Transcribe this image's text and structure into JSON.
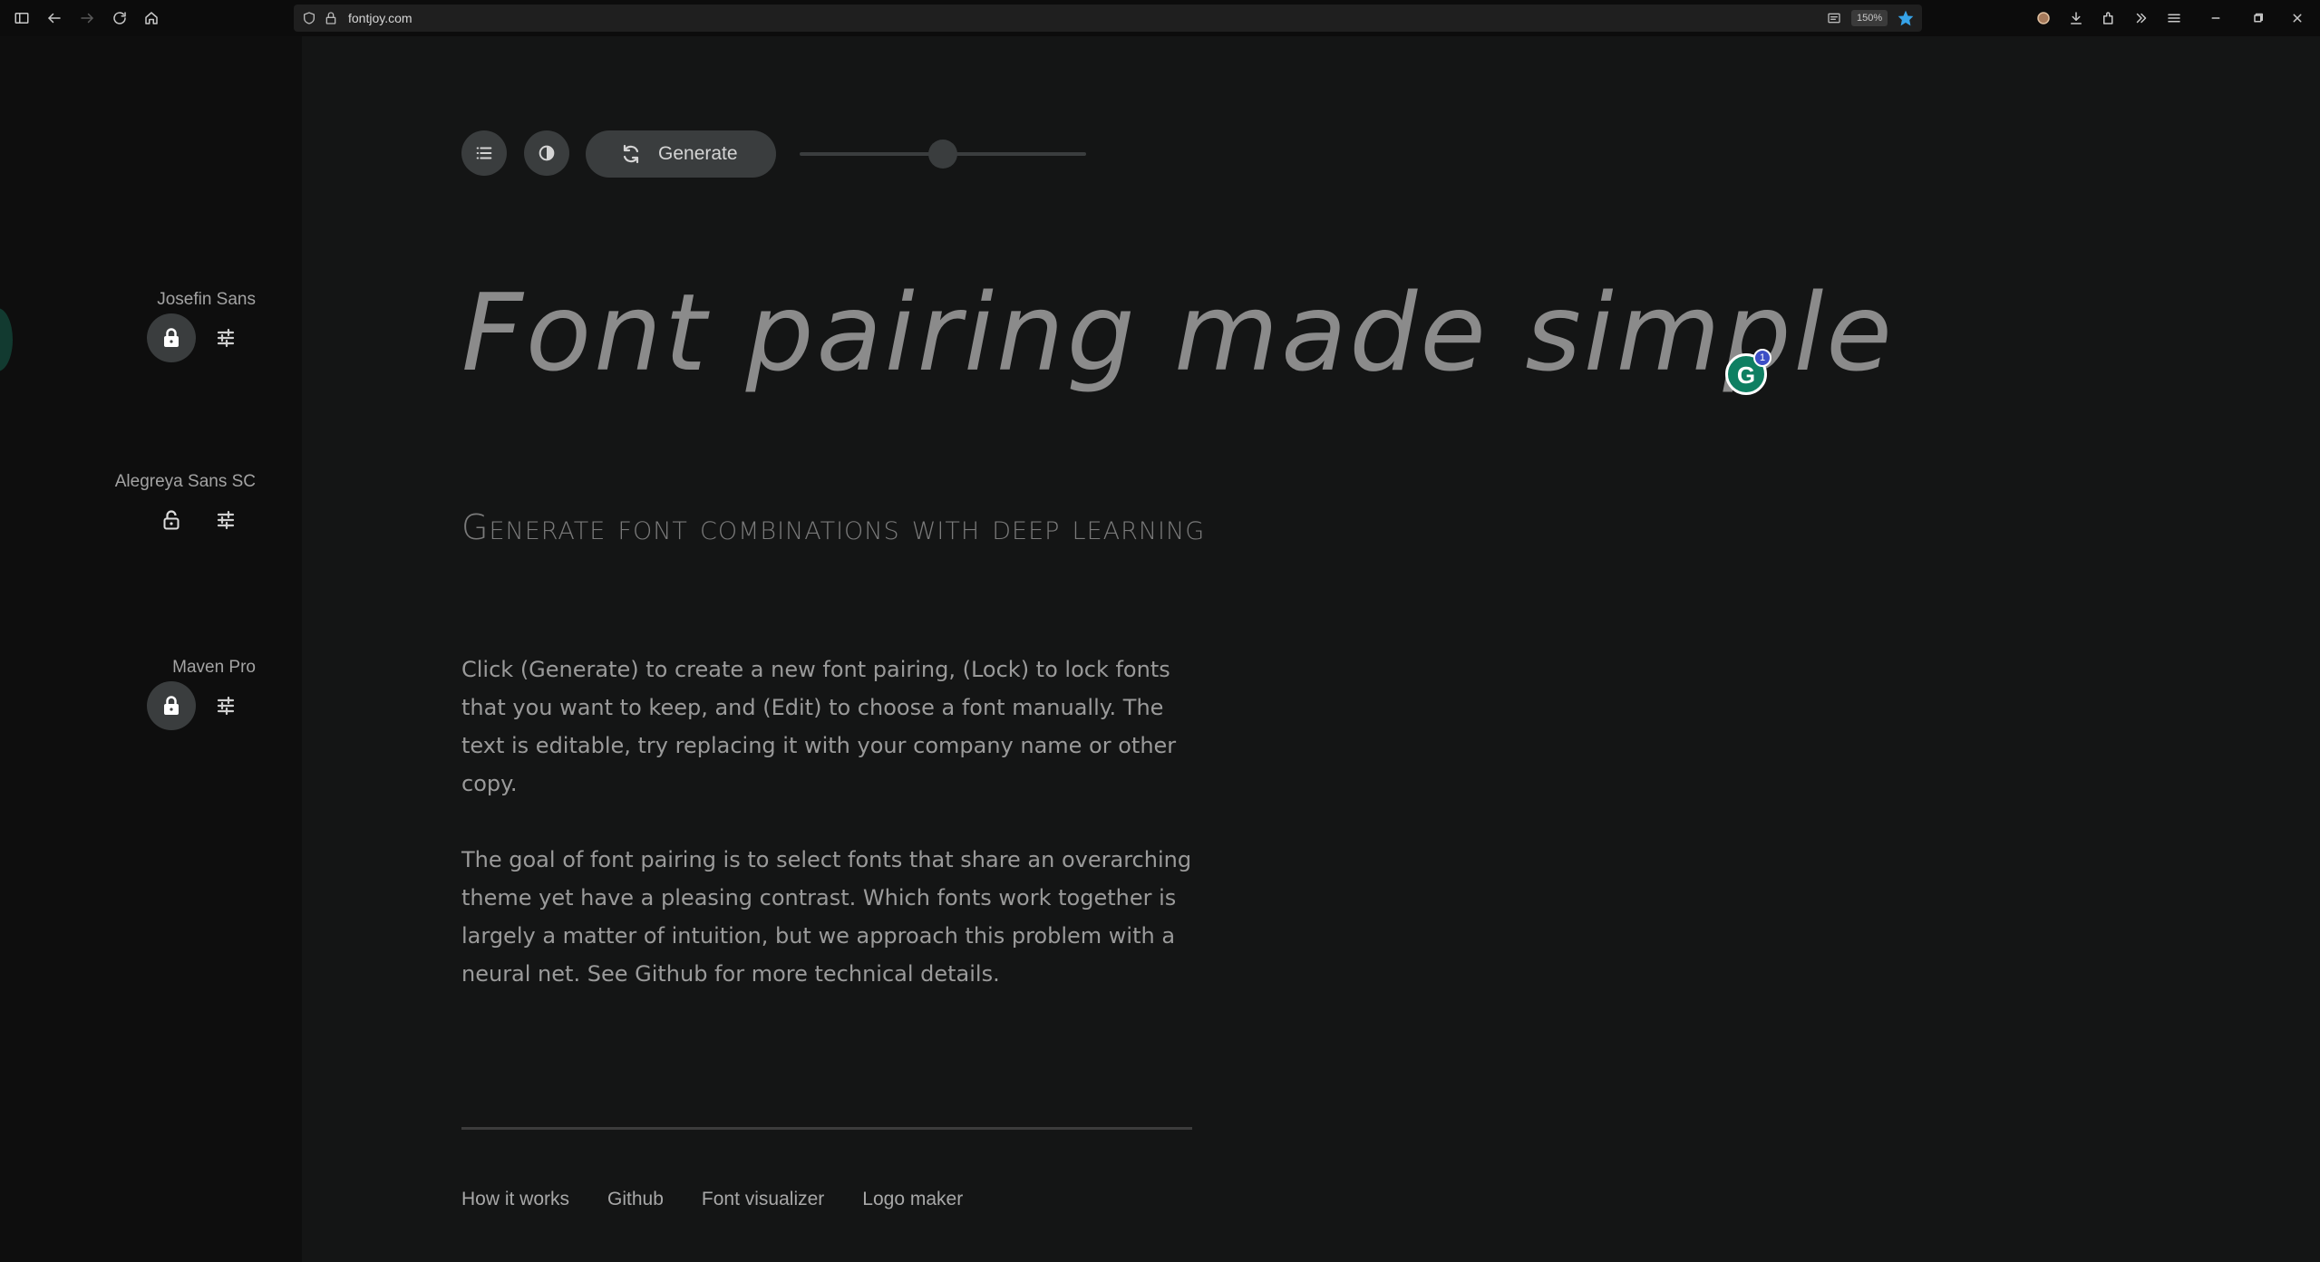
{
  "browser": {
    "url": "fontjoy.com",
    "zoom": "150%"
  },
  "sidebar": {
    "fonts": [
      {
        "name": "Josefin Sans",
        "locked": true
      },
      {
        "name": "Alegreya Sans SC",
        "locked": false
      },
      {
        "name": "Maven Pro",
        "locked": true
      }
    ]
  },
  "toolbar": {
    "generate_label": "Generate",
    "slider_value": 0.5
  },
  "main": {
    "headline": "Font pairing made simple",
    "subheading": "Generate font combinations with deep learning",
    "paragraph_1": "Click (Generate) to create a new font pairing, (Lock) to lock fonts that you want to keep, and (Edit) to choose a font manually. The text is editable, try replacing it with your company name or other copy.",
    "paragraph_2": "The goal of font pairing is to select fonts that share an overarching theme yet have a pleasing contrast. Which fonts work together is largely a matter of intuition, but we approach this problem with a neural net. See Github for more technical details."
  },
  "grammarly": {
    "letter": "G",
    "count": "1"
  },
  "footer": {
    "links": [
      "How it works",
      "Github",
      "Font visualizer",
      "Logo maker"
    ]
  },
  "colors": {
    "background": "#141515",
    "sidebar": "#0e0e0e",
    "button": "#3a3d3e",
    "bookmark_star": "#36a3e8",
    "grammarly": "#0e7f62"
  }
}
